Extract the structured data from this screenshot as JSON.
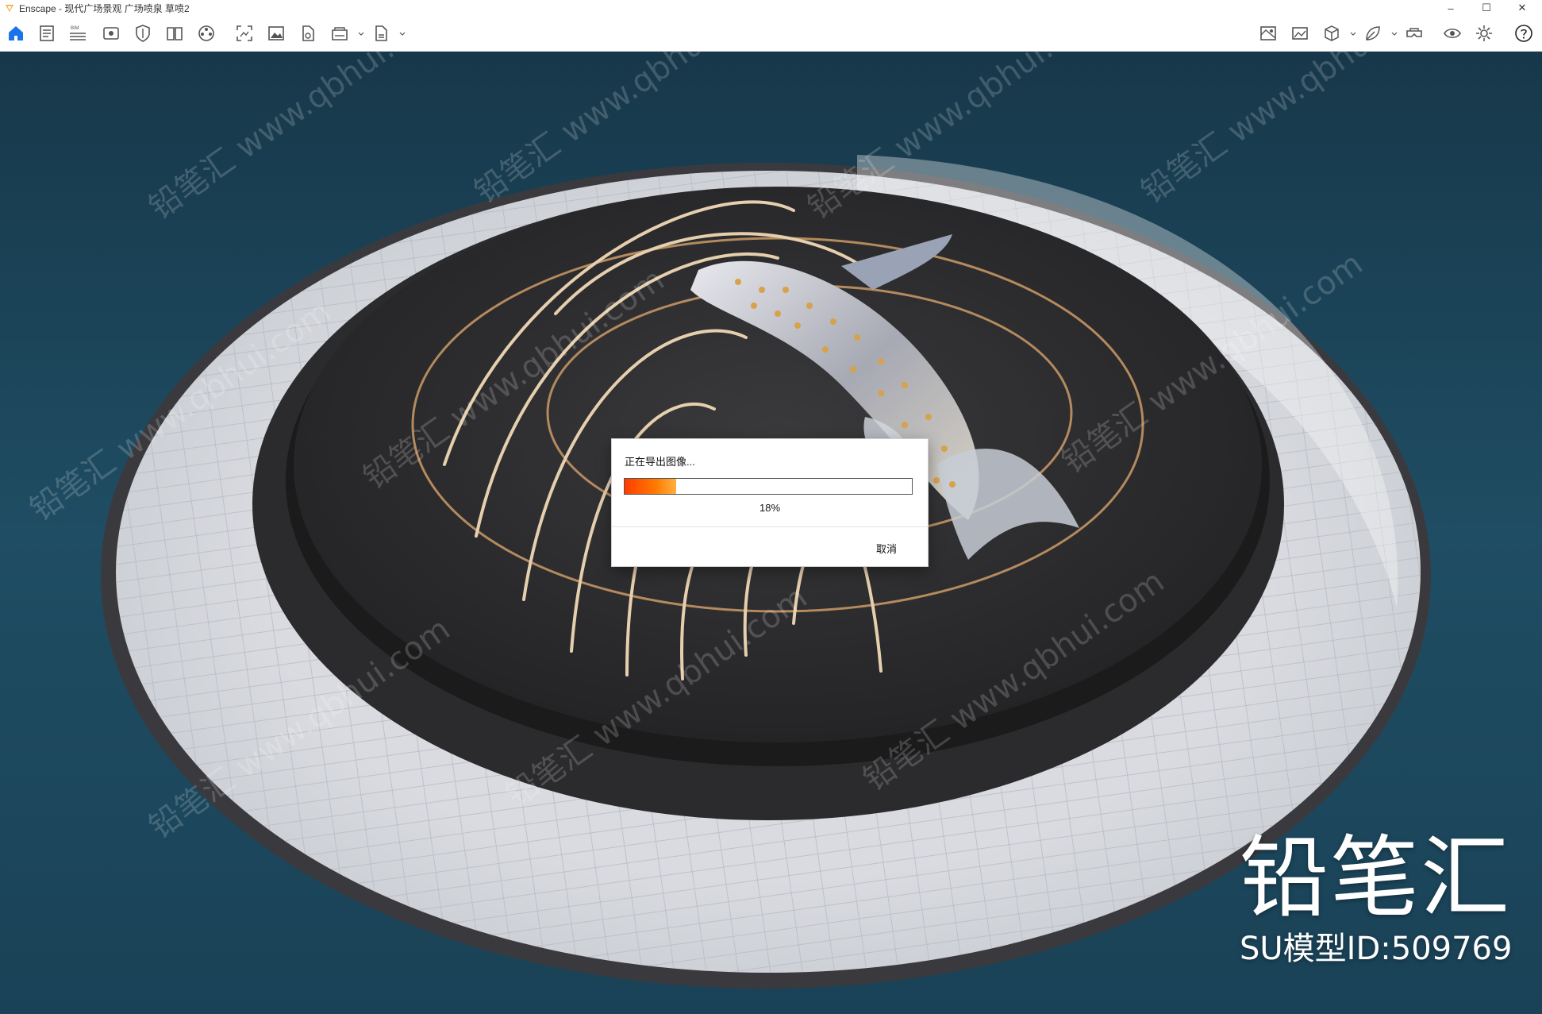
{
  "window": {
    "title": "Enscape - 现代广场景观 广场喷泉 草喷2",
    "controls": {
      "minimize": "–",
      "maximize": "☐",
      "close": "✕"
    }
  },
  "toolbar": {
    "left_icons": [
      "home-icon",
      "document-icon",
      "bim-icon",
      "view-icon",
      "shield-icon",
      "book-icon",
      "film-reel-icon",
      "screenshot-icon",
      "image-icon",
      "file-icon",
      "panorama-360-icon",
      "export-exe-icon"
    ],
    "bim_label": "BIM",
    "right_icons": [
      "map-icon",
      "image-gallery-icon",
      "cube-icon",
      "leaf-icon",
      "vr-headset-icon",
      "eye-icon",
      "settings-icon",
      "help-icon"
    ]
  },
  "dialog": {
    "message": "正在导出图像...",
    "progress_percent": 18,
    "progress_label": "18%",
    "cancel_label": "取消"
  },
  "watermark": {
    "brand": "铅笔汇",
    "model_id": "SU模型ID:509769",
    "tile_text": "铅笔汇 www.qbhui.com"
  },
  "colors": {
    "accent": "#1a73e8",
    "progress_start": "#ff3c00",
    "progress_end": "#ffb040",
    "water": "#1d4a5e"
  }
}
